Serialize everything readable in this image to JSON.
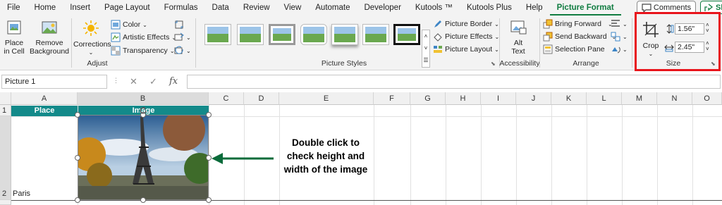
{
  "menu": {
    "tabs": [
      "File",
      "Home",
      "Insert",
      "Page Layout",
      "Formulas",
      "Data",
      "Review",
      "View",
      "Automate",
      "Developer",
      "Kutools ™",
      "Kutools Plus",
      "Help",
      "Picture Format"
    ],
    "active": "Picture Format",
    "comments": "Comments",
    "share": "Sh"
  },
  "ribbon": {
    "adjust": {
      "label": "Adjust",
      "place_in_cell": "Place\nin Cell",
      "remove_background": "Remove\nBackground",
      "corrections": "Corrections",
      "color": "Color",
      "artistic_effects": "Artistic Effects",
      "transparency": "Transparency"
    },
    "picture_styles": {
      "label": "Picture Styles",
      "picture_border": "Picture Border",
      "picture_effects": "Picture Effects",
      "picture_layout": "Picture Layout"
    },
    "accessibility": {
      "label": "Accessibility",
      "alt_text": "Alt\nText"
    },
    "arrange": {
      "label": "Arrange",
      "bring_forward": "Bring Forward",
      "send_backward": "Send Backward",
      "selection_pane": "Selection Pane"
    },
    "size": {
      "label": "Size",
      "crop": "Crop",
      "height": "1.56\"",
      "width": "2.45\""
    }
  },
  "formula_bar": {
    "name_box": "Picture 1",
    "cancel": "✕",
    "enter": "✓",
    "fx": "fx"
  },
  "sheet": {
    "columns": [
      "A",
      "B",
      "C",
      "D",
      "E",
      "F",
      "G",
      "H",
      "I",
      "J",
      "K",
      "L",
      "M",
      "N",
      "O"
    ],
    "rows": [
      "1",
      "2"
    ],
    "header_place": "Place",
    "header_image": "Image",
    "cell_a2": "Paris",
    "note": "Double click to check height and width of the image"
  },
  "colors": {
    "accent": "#107c41",
    "header_fill": "#138a8a",
    "highlight": "#e8141c",
    "arrow": "#0a6b3a"
  }
}
